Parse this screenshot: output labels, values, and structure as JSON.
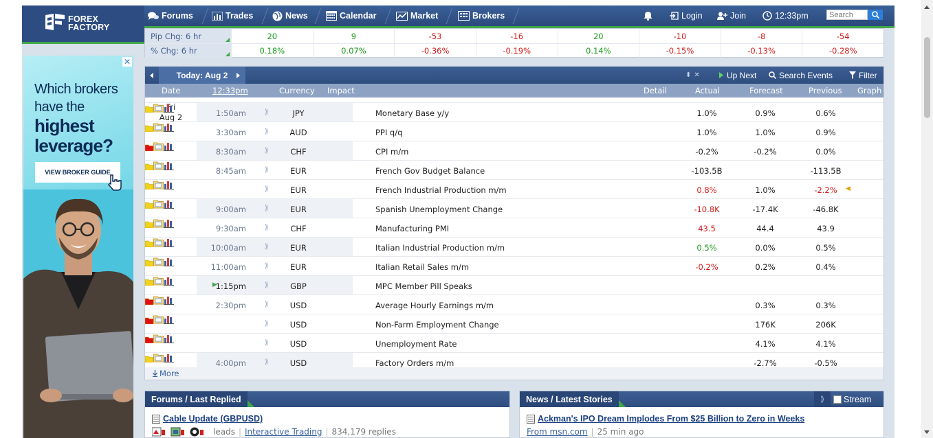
{
  "brand": {
    "line1": "FOREX",
    "line2": "FACTORY"
  },
  "nav": [
    {
      "label": "Forums",
      "icon": "chat-icon"
    },
    {
      "label": "Trades",
      "icon": "bars-icon"
    },
    {
      "label": "News",
      "icon": "globe-icon"
    },
    {
      "label": "Calendar",
      "icon": "calendar-icon"
    },
    {
      "label": "Market",
      "icon": "chart-icon"
    },
    {
      "label": "Brokers",
      "icon": "building-icon"
    }
  ],
  "header": {
    "login": "Login",
    "join": "Join",
    "time": "12:33pm",
    "search_placeholder": "Search"
  },
  "pip": {
    "row1_label": "Pip Chg: 6 hr",
    "row1": [
      "20",
      "9",
      "-53",
      "-16",
      "20",
      "-10",
      "-8",
      "-54"
    ],
    "row2_label": "% Chg: 6 hr",
    "row2": [
      "0.18%",
      "0.07%",
      "-0.36%",
      "-0.19%",
      "0.14%",
      "-0.15%",
      "-0.13%",
      "-0.28%"
    ]
  },
  "ad": {
    "close": "✕",
    "line1": "Which brokers",
    "line2": "have the",
    "line3": "highest",
    "line4": "leverage?",
    "cta": "VIEW BROKER GUIDE"
  },
  "calendar": {
    "today": "Today: Aug 2",
    "up_next": "Up Next",
    "search_events": "Search Events",
    "filter": "Filter",
    "headers": {
      "date": "Date",
      "time": "12:33pm",
      "currency": "Currency",
      "impact": "Impact",
      "detail": "Detail",
      "actual": "Actual",
      "forecast": "Forecast",
      "previous": "Previous",
      "graph": "Graph"
    },
    "day": "Fri",
    "date": "Aug 2",
    "rows": [
      {
        "time": "1:50am",
        "cur": "JPY",
        "impact": "yellow",
        "event": "Monetary Base y/y",
        "actual": "1.0%",
        "actual_color": "",
        "forecast": "0.9%",
        "previous": "0.6%",
        "previous_color": ""
      },
      {
        "time": "3:30am",
        "cur": "AUD",
        "impact": "yellow",
        "event": "PPI q/q",
        "actual": "1.0%",
        "actual_color": "",
        "forecast": "1.0%",
        "previous": "0.9%",
        "previous_color": ""
      },
      {
        "time": "8:30am",
        "cur": "CHF",
        "impact": "red",
        "event": "CPI m/m",
        "actual": "-0.2%",
        "actual_color": "",
        "forecast": "-0.2%",
        "previous": "0.0%",
        "previous_color": ""
      },
      {
        "time": "8:45am",
        "cur": "EUR",
        "impact": "yellow",
        "event": "French Gov Budget Balance",
        "actual": "-103.5B",
        "actual_color": "",
        "forecast": "",
        "previous": "-113.5B",
        "previous_color": ""
      },
      {
        "time": "",
        "cur": "EUR",
        "impact": "yellow",
        "event": "French Industrial Production m/m",
        "actual": "0.8%",
        "actual_color": "red",
        "forecast": "1.0%",
        "previous": "-2.2%",
        "previous_color": "red"
      },
      {
        "time": "9:00am",
        "cur": "EUR",
        "impact": "yellow",
        "event": "Spanish Unemployment Change",
        "actual": "-10.8K",
        "actual_color": "red",
        "forecast": "-17.4K",
        "previous": "-46.8K",
        "previous_color": ""
      },
      {
        "time": "9:30am",
        "cur": "CHF",
        "impact": "yellow",
        "event": "Manufacturing PMI",
        "actual": "43.5",
        "actual_color": "red",
        "forecast": "44.4",
        "previous": "43.9",
        "previous_color": ""
      },
      {
        "time": "10:00am",
        "cur": "EUR",
        "impact": "yellow",
        "event": "Italian Industrial Production m/m",
        "actual": "0.5%",
        "actual_color": "green",
        "forecast": "0.0%",
        "previous": "0.5%",
        "previous_color": ""
      },
      {
        "time": "11:00am",
        "cur": "EUR",
        "impact": "yellow",
        "event": "Italian Retail Sales m/m",
        "actual": "-0.2%",
        "actual_color": "red",
        "forecast": "0.2%",
        "previous": "0.4%",
        "previous_color": ""
      },
      {
        "time": "1:15pm",
        "cur": "GBP",
        "impact": "yellow",
        "event": "MPC Member Pill Speaks",
        "actual": "",
        "actual_color": "",
        "forecast": "",
        "previous": "",
        "previous_color": ""
      },
      {
        "time": "2:30pm",
        "cur": "USD",
        "impact": "red",
        "event": "Average Hourly Earnings m/m",
        "actual": "",
        "actual_color": "",
        "forecast": "0.3%",
        "previous": "0.3%",
        "previous_color": ""
      },
      {
        "time": "",
        "cur": "USD",
        "impact": "red",
        "event": "Non-Farm Employment Change",
        "actual": "",
        "actual_color": "",
        "forecast": "176K",
        "previous": "206K",
        "previous_color": ""
      },
      {
        "time": "",
        "cur": "USD",
        "impact": "red",
        "event": "Unemployment Rate",
        "actual": "",
        "actual_color": "",
        "forecast": "4.1%",
        "previous": "4.1%",
        "previous_color": ""
      },
      {
        "time": "4:00pm",
        "cur": "USD",
        "impact": "yellow",
        "event": "Factory Orders m/m",
        "actual": "",
        "actual_color": "",
        "forecast": "-2.7%",
        "previous": "-0.5%",
        "previous_color": ""
      }
    ],
    "more": "More"
  },
  "forums": {
    "title": "Forums / Last Replied",
    "thread": "Cable Update (GBPUSD)",
    "leads": "leads",
    "category": "Interactive Trading",
    "replies": "834,179 replies"
  },
  "news": {
    "title": "News / Latest Stories",
    "stream": "Stream",
    "headline": "Ackman's IPO Dream Implodes From $25 Billion to Zero in Weeks",
    "source": "From msn.com",
    "age": "25 min ago"
  },
  "colors": {
    "nav_blue": "#2f4e80",
    "accent_green": "#3fa84a",
    "negative": "#d21c1c",
    "positive": "#1a9a1a",
    "high_impact": "#e01010",
    "low_impact": "#f2d21a"
  }
}
